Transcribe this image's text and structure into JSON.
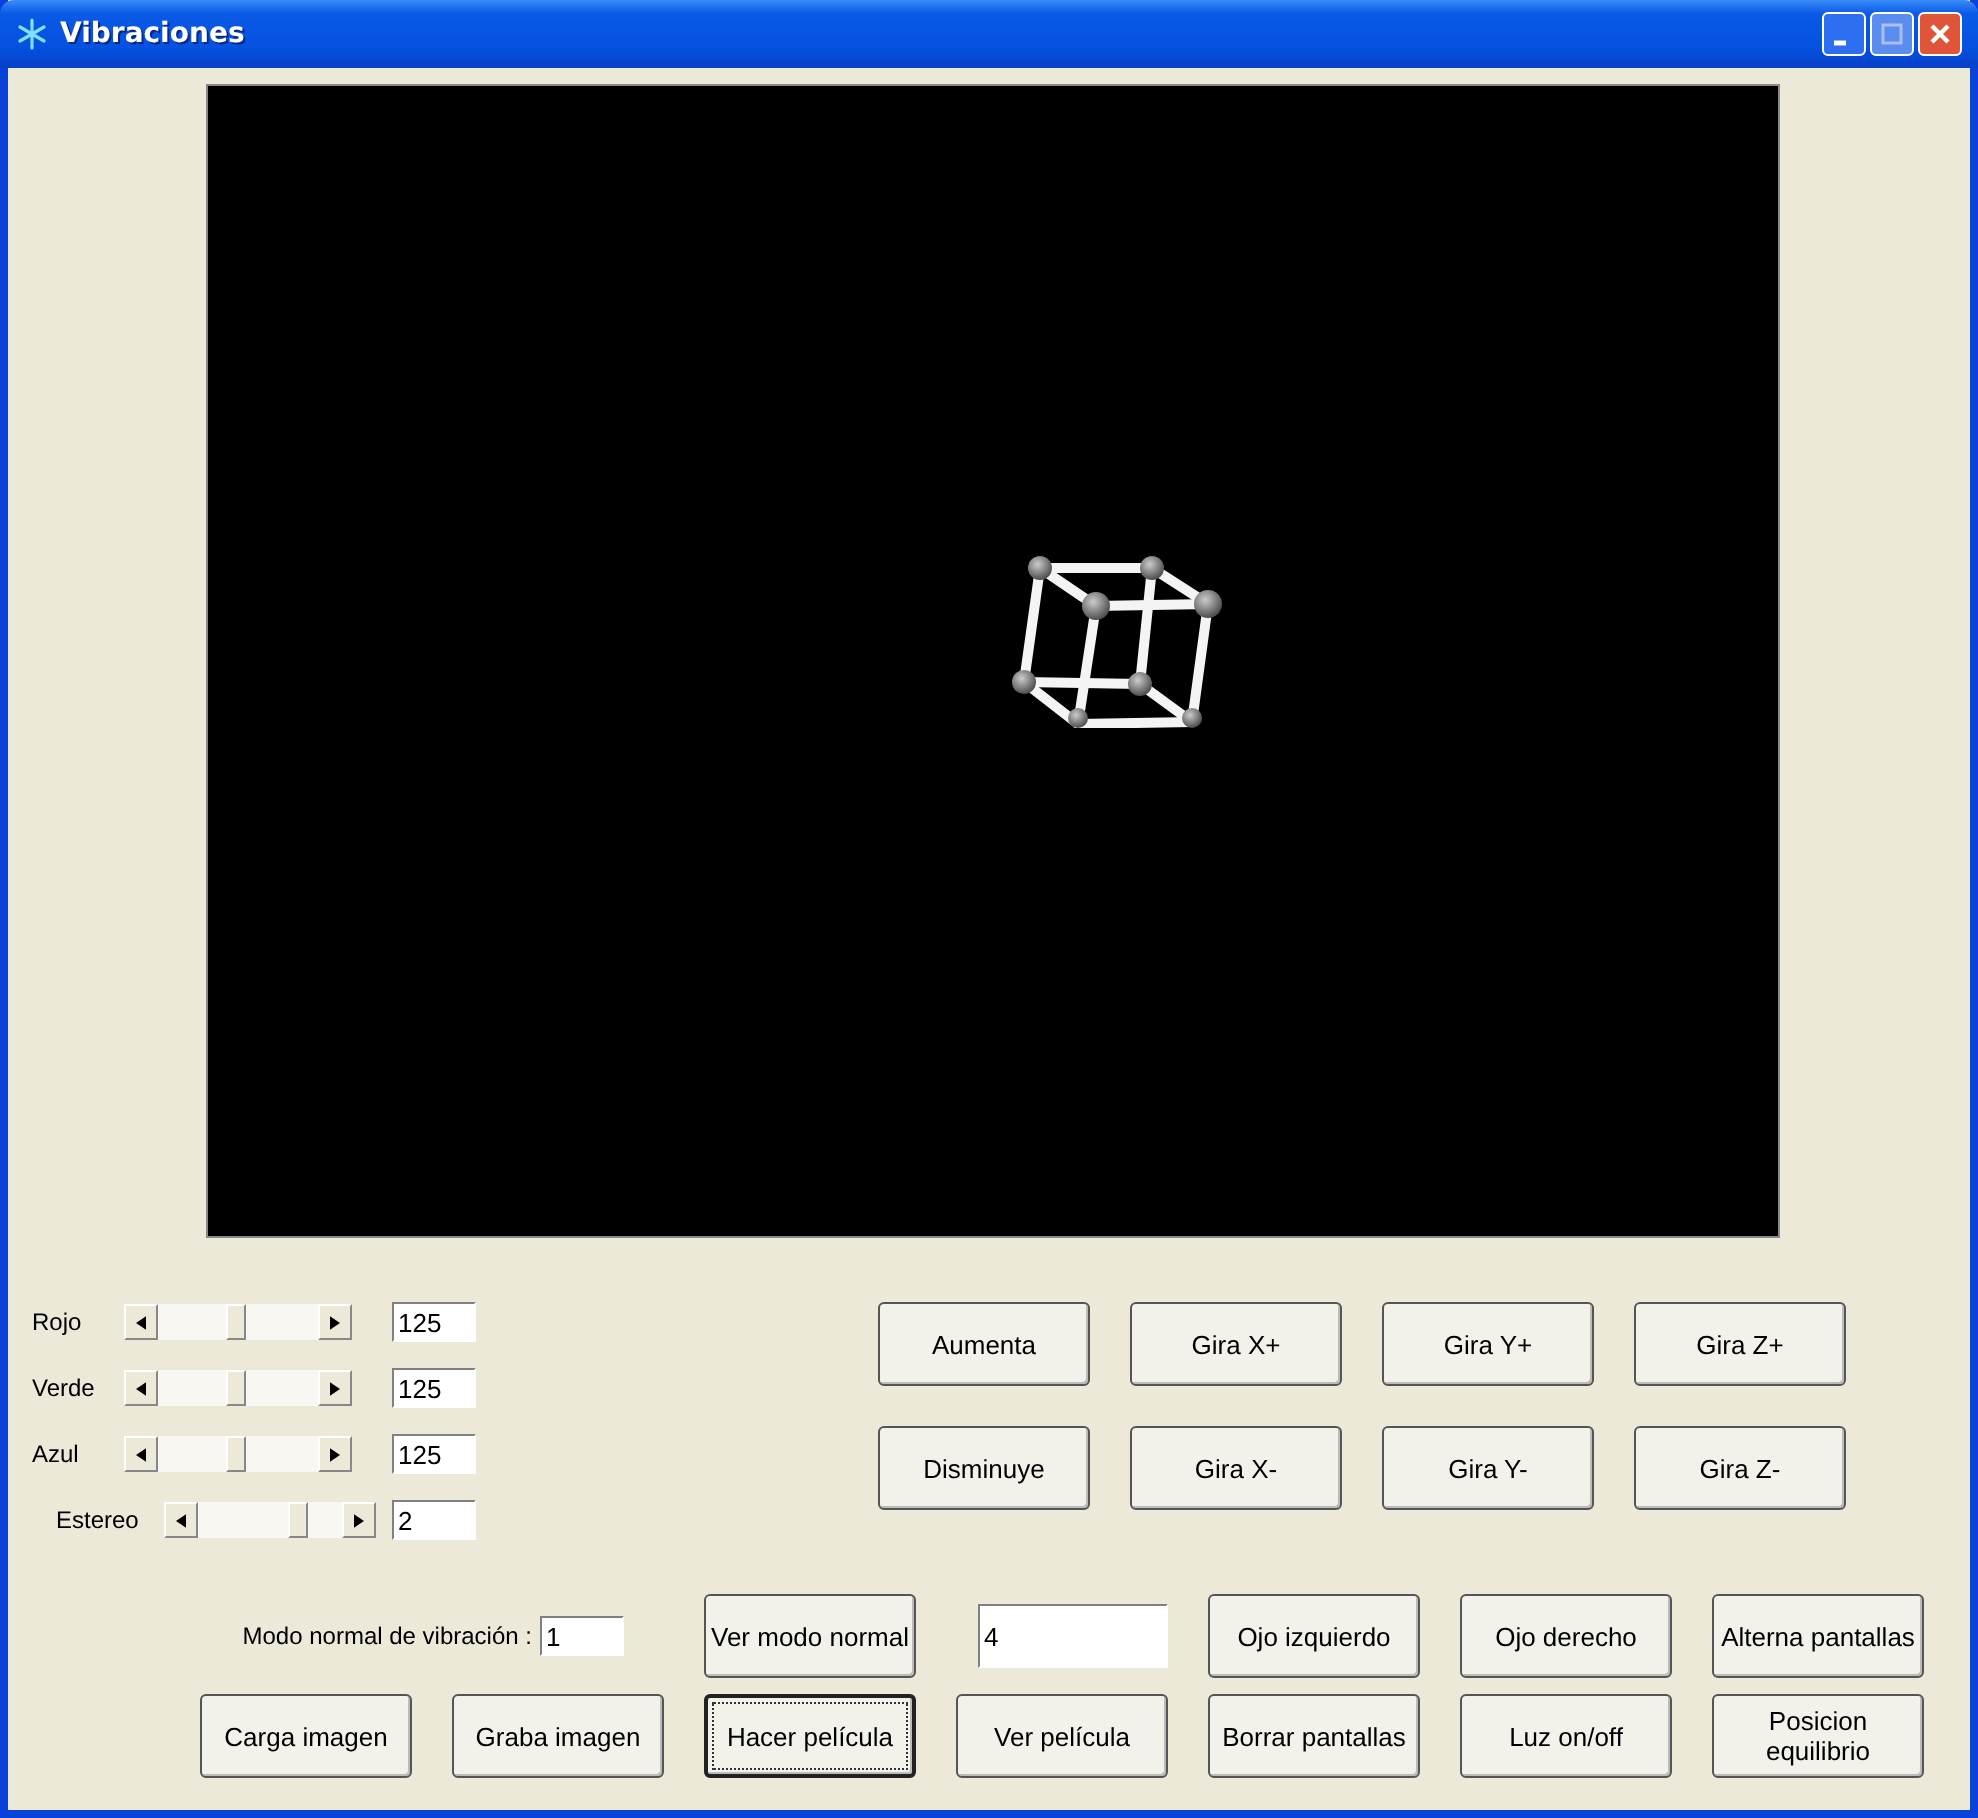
{
  "window": {
    "title": "Vibraciones"
  },
  "color_sliders": [
    {
      "label": "Rojo",
      "level": 0.49,
      "value": "125"
    },
    {
      "label": "Verde",
      "level": 0.49,
      "value": "125"
    },
    {
      "label": "Azul",
      "level": 0.49,
      "value": "125"
    }
  ],
  "stereo": {
    "label": "Estereo",
    "level": 0.7,
    "value": "2"
  },
  "view_buttons": [
    {
      "label": "Aumenta",
      "focused": false
    },
    {
      "label": "Gira X+",
      "focused": false
    },
    {
      "label": "Gira Y+",
      "focused": false
    },
    {
      "label": "Gira Z+",
      "focused": false
    },
    {
      "label": "Disminuye",
      "focused": false
    },
    {
      "label": "Gira X-",
      "focused": false
    },
    {
      "label": "Gira Y-",
      "focused": false
    },
    {
      "label": "Gira Z-",
      "focused": false
    }
  ],
  "mode": {
    "label": "Modo normal de vibración :",
    "value": "1",
    "button": {
      "label": "Ver modo normal",
      "focused": false
    },
    "count": "4"
  },
  "mode_row_buttons": [
    {
      "label": "Ojo izquierdo",
      "focused": false
    },
    {
      "label": "Ojo derecho",
      "focused": false
    },
    {
      "label": "Alterna pantallas",
      "focused": false
    }
  ],
  "bottom_buttons": [
    {
      "label": "Carga imagen",
      "focused": false
    },
    {
      "label": "Graba imagen",
      "focused": false
    },
    {
      "label": "Hacer película",
      "focused": true
    },
    {
      "label": "Ver película",
      "focused": false
    },
    {
      "label": "Borrar pantallas",
      "focused": false
    },
    {
      "label": "Luz on/off",
      "focused": false
    },
    {
      "label": "Posicion equilibrio",
      "focused": false
    }
  ]
}
